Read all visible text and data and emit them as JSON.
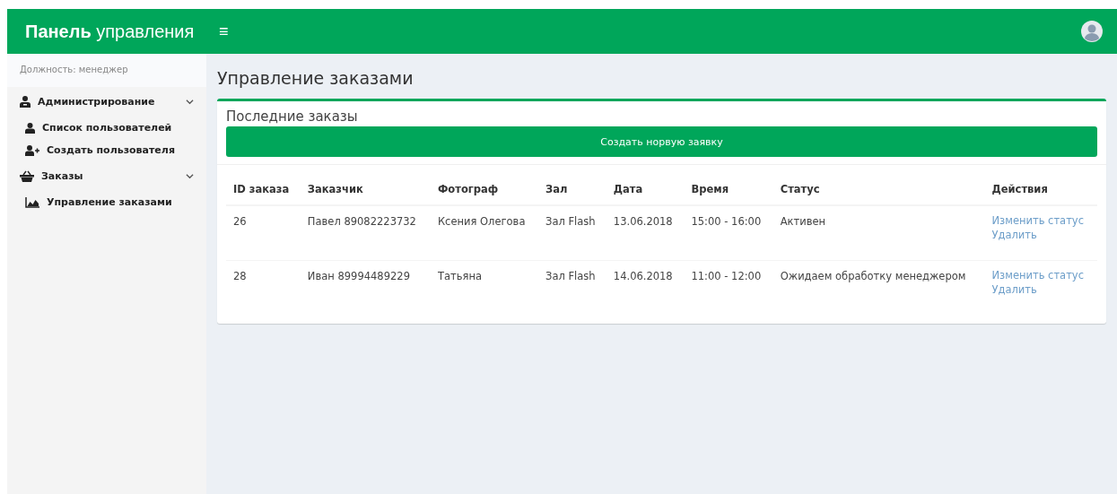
{
  "header": {
    "brand": "**Панель** управления",
    "menu_toggle": "≡"
  },
  "sidebar": {
    "role": "Должность: менеджер",
    "sections": [
      {
        "label": "Администрирование",
        "expanded": true,
        "children": [
          {
            "label": "Список пользователей"
          },
          {
            "label": "Создать пользователя"
          }
        ]
      },
      {
        "label": "Заказы",
        "expanded": true,
        "children": [
          {
            "label": "Управление заказами"
          }
        ]
      }
    ]
  },
  "page": {
    "title": "Управление заказами",
    "card": {
      "title": "Последние заказы",
      "create_button": "Создать норвую заявку",
      "table": {
        "columns": [
          "ID заказа",
          "Заказчик",
          "Фотограф",
          "Зал",
          "Дата",
          "Время",
          "Статус",
          "Действия"
        ],
        "rows": [
          {
            "cells": [
              "26",
              "Павел 89082223732",
              "Ксения Олегова",
              "Зал Flash",
              "13.06.2018",
              "15:00 - 16:00",
              "Активен"
            ],
            "actions": [
              "Изменить статус",
              "Удалить"
            ]
          },
          {
            "cells": [
              "28",
              "Иван 89994489229",
              "Татьяна",
              "Зал Flash",
              "14.06.2018",
              "11:00 - 12:00",
              "Ожидаем обработку менеджером"
            ],
            "actions": [
              "Изменить статус",
              "Удалить"
            ]
          }
        ]
      }
    }
  }
}
